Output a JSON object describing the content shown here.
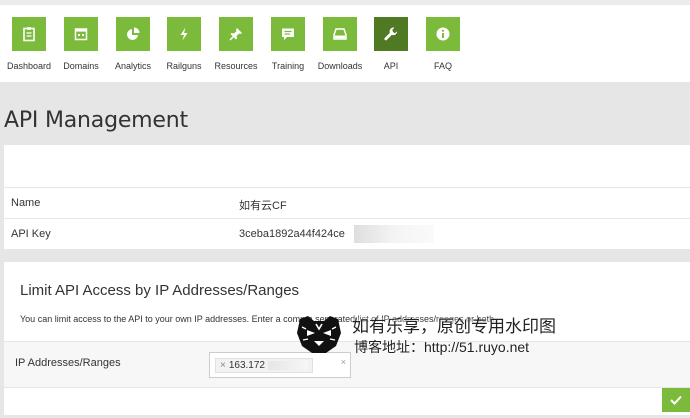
{
  "nav": {
    "items": [
      {
        "label": "Dashboard",
        "icon": "clipboard-icon"
      },
      {
        "label": "Domains",
        "icon": "calendar-icon"
      },
      {
        "label": "Analytics",
        "icon": "pie-chart-icon"
      },
      {
        "label": "Railguns",
        "icon": "lightning-icon"
      },
      {
        "label": "Resources",
        "icon": "pushpin-icon"
      },
      {
        "label": "Training",
        "icon": "chat-icon"
      },
      {
        "label": "Downloads",
        "icon": "hard-drive-icon"
      },
      {
        "label": "API",
        "icon": "wrench-icon",
        "active": true
      },
      {
        "label": "FAQ",
        "icon": "info-icon"
      }
    ]
  },
  "page": {
    "title": "API Management"
  },
  "details": {
    "name_label": "Name",
    "name_value": "如有云CF",
    "apikey_label": "API Key",
    "apikey_value": "3ceba1892a44f424ce"
  },
  "limit": {
    "title": "Limit API Access by IP Addresses/Ranges",
    "description": "You can limit access to the API to your own IP addresses. Enter a comma separated list of IP addresses/ranges or both.",
    "ip_label": "IP Addresses/Ranges",
    "ip_tag": "163.172",
    "tag_remove": "×",
    "clear": "×"
  },
  "watermark": {
    "line1": "如有乐享，原创专用水印图",
    "line2": "博客地址：http://51.ruyo.net"
  },
  "colors": {
    "accent": "#7cba3c",
    "accent_active": "#4f7a23"
  }
}
